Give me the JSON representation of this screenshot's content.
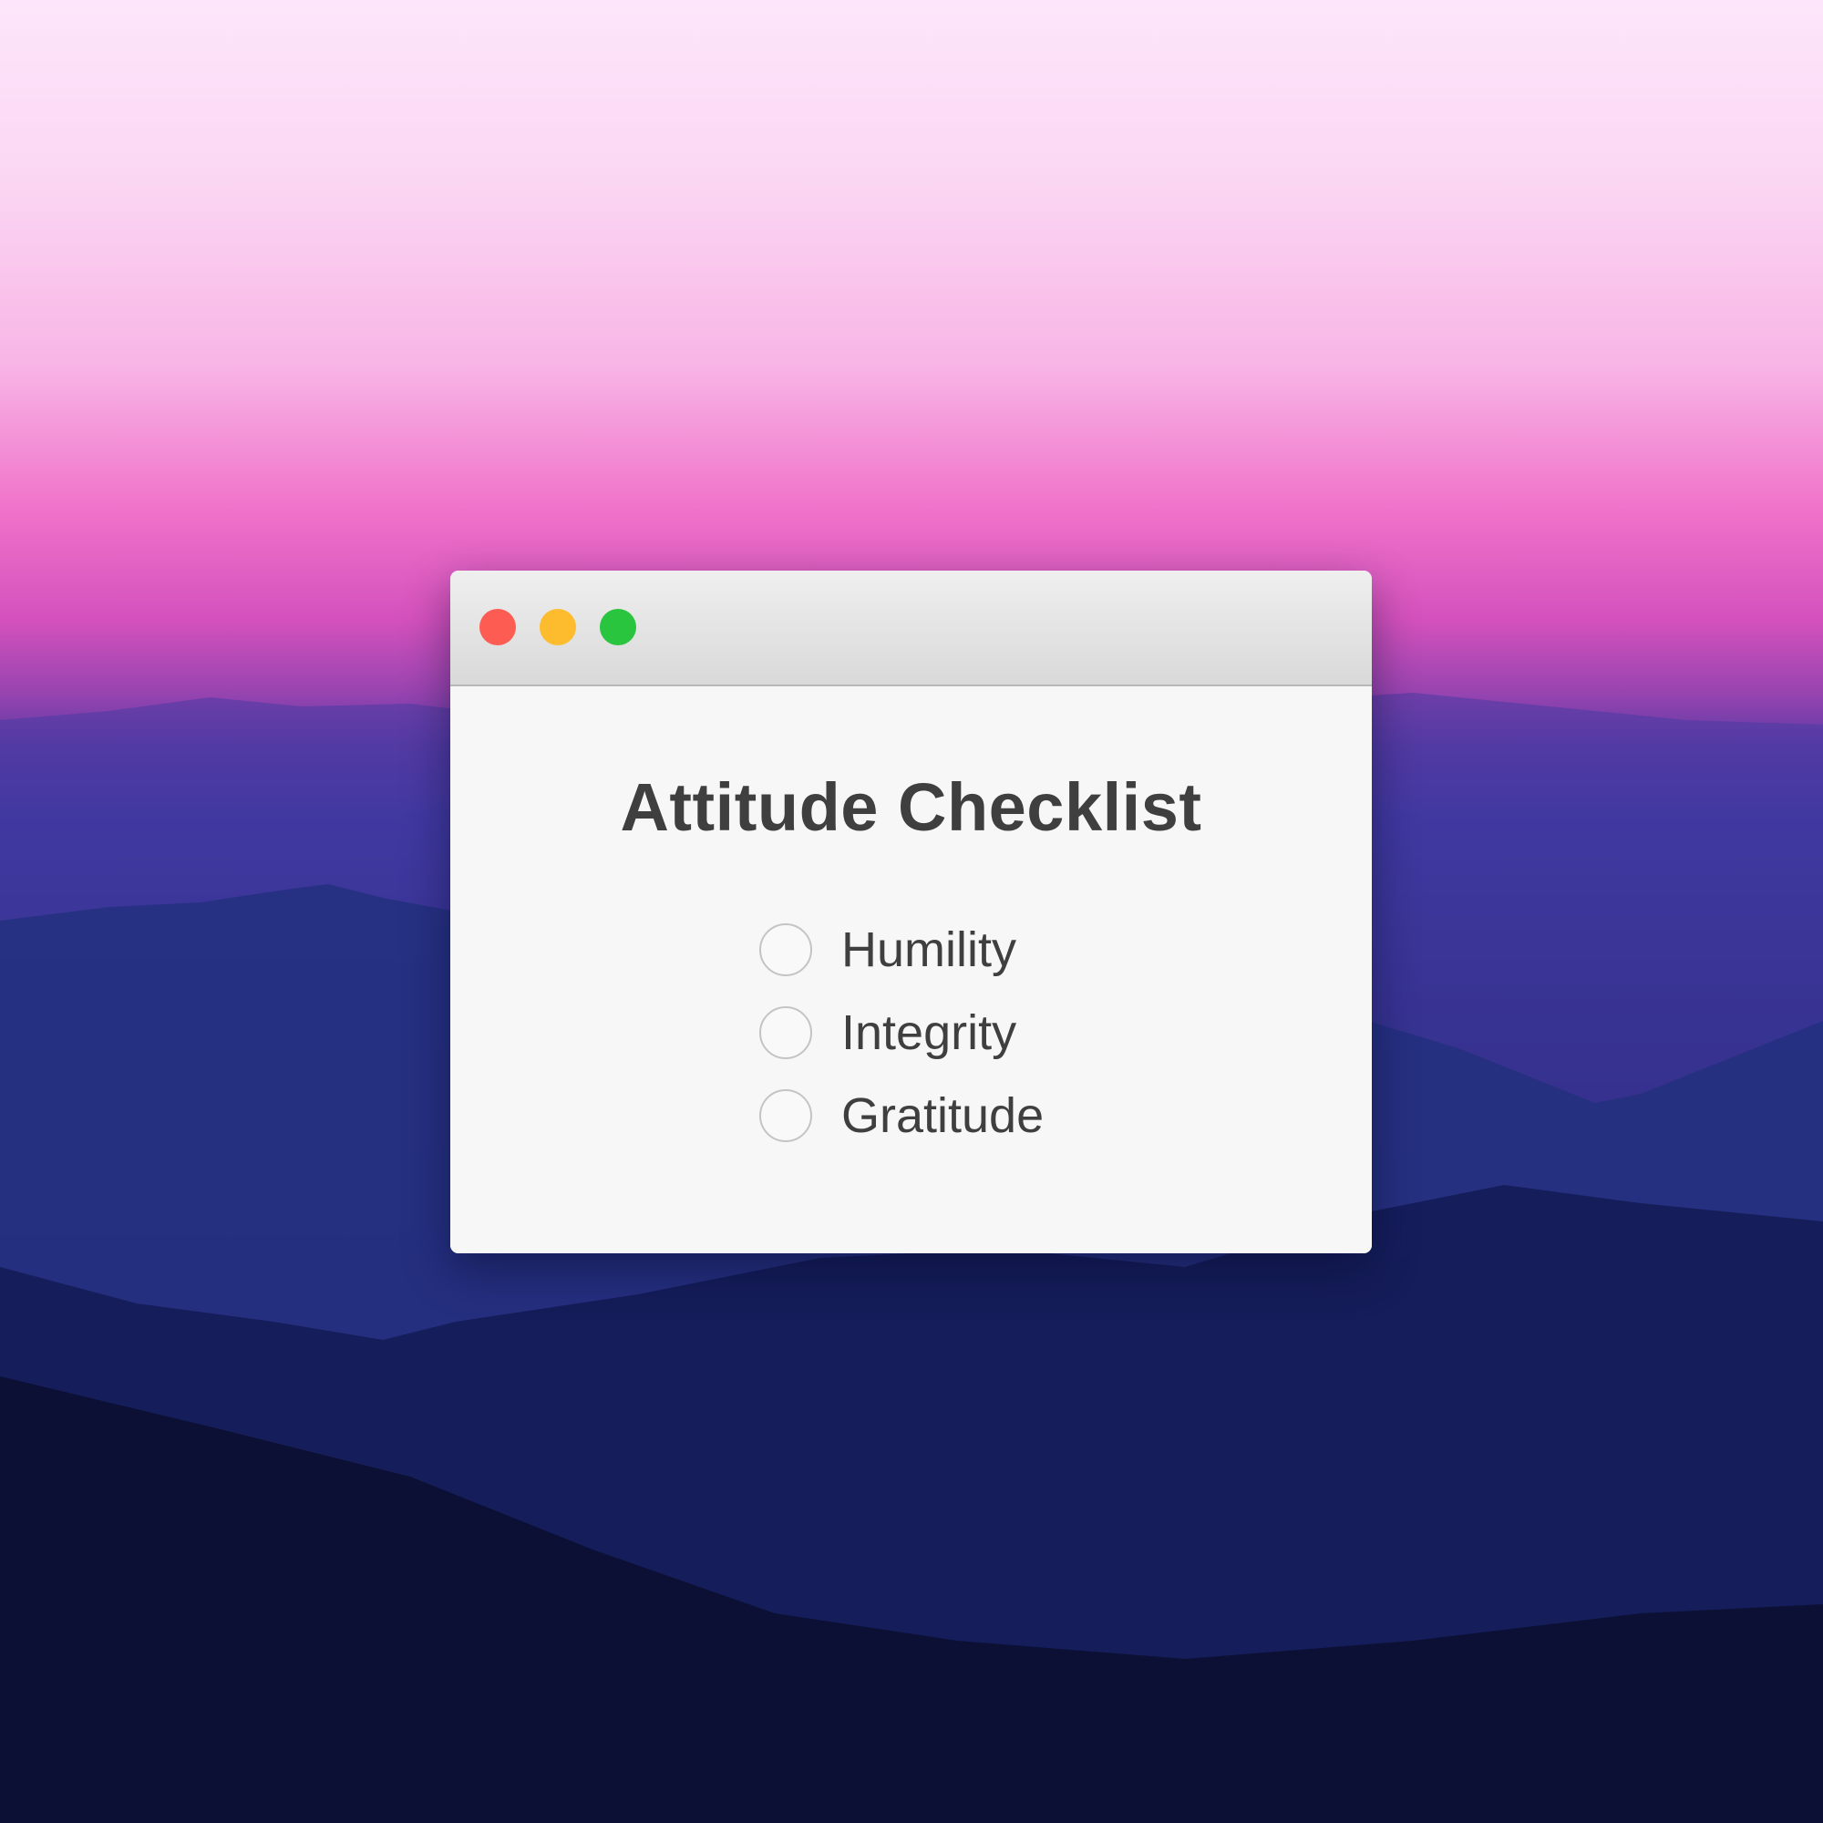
{
  "window": {
    "title": "Attitude Checklist",
    "controls": [
      {
        "name": "close",
        "color": "#fc5c52"
      },
      {
        "name": "minimize",
        "color": "#fdbc2e"
      },
      {
        "name": "zoom",
        "color": "#29c53f"
      }
    ]
  },
  "checklist": {
    "items": [
      {
        "label": "Humility",
        "checked": false
      },
      {
        "label": "Integrity",
        "checked": false
      },
      {
        "label": "Gratitude",
        "checked": false
      }
    ]
  },
  "wallpaper": {
    "description_colors": [
      "#fde6fb",
      "#ef72c9",
      "#5b3aa5",
      "#222c82",
      "#080b22"
    ]
  }
}
